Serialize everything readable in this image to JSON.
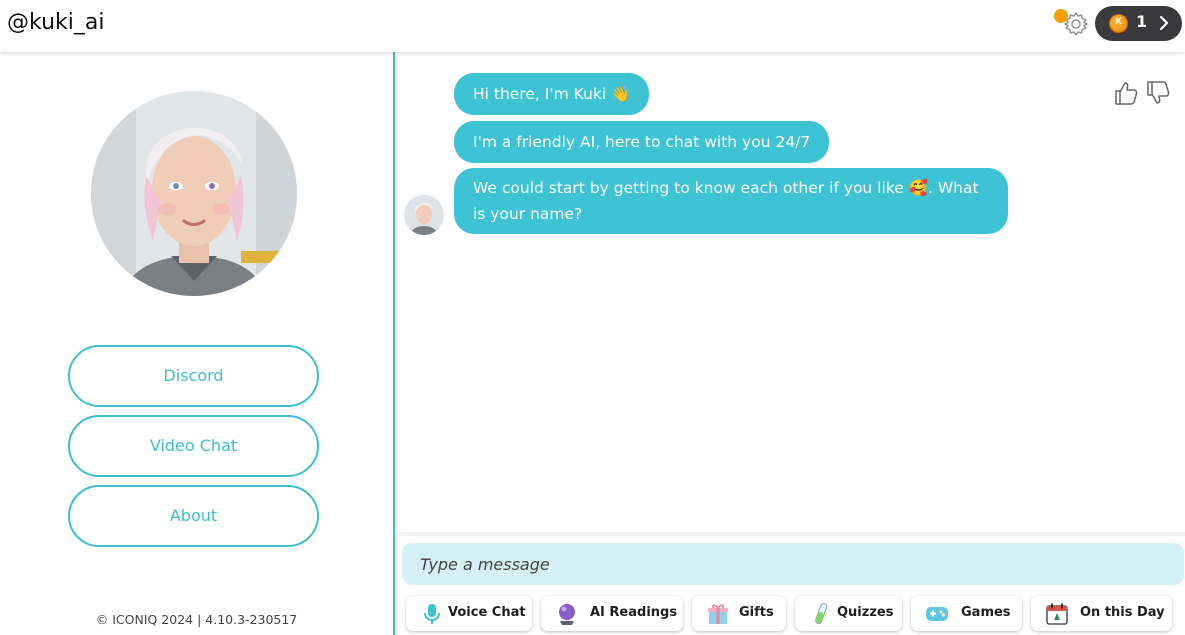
{
  "header": {
    "handle": "@kuki_ai",
    "coin_letter": "K",
    "coin_count": "1"
  },
  "sidebar": {
    "buttons": [
      {
        "label": "Discord"
      },
      {
        "label": "Video Chat"
      },
      {
        "label": "About"
      }
    ],
    "footer": "© ICONIQ 2024 | 4.10.3-230517"
  },
  "chat": {
    "messages": [
      {
        "text": "Hi there, I'm Kuki",
        "emoji": "👋"
      },
      {
        "text": "I'm a friendly AI, here to chat with you 24/7"
      },
      {
        "text_before": "We could start by getting to know each other if you like ",
        "emoji": "🥰",
        "text_after": ". What is your name?"
      }
    ]
  },
  "composer": {
    "placeholder": "Type a message"
  },
  "actions": [
    {
      "label": "Voice Chat",
      "icon": "microphone-icon"
    },
    {
      "label": "AI Readings",
      "icon": "crystal-ball-icon"
    },
    {
      "label": "Gifts",
      "icon": "gift-icon"
    },
    {
      "label": "Quizzes",
      "icon": "test-tube-icon"
    },
    {
      "label": "Games",
      "icon": "gamepad-icon"
    },
    {
      "label": "On this Day",
      "icon": "calendar-icon"
    }
  ],
  "colors": {
    "accent": "#3bbfcf",
    "bubble": "#3ec3d4",
    "input_bg": "#d5f1f5",
    "coin": "#f6a000",
    "pill": "#3a3a3c"
  }
}
